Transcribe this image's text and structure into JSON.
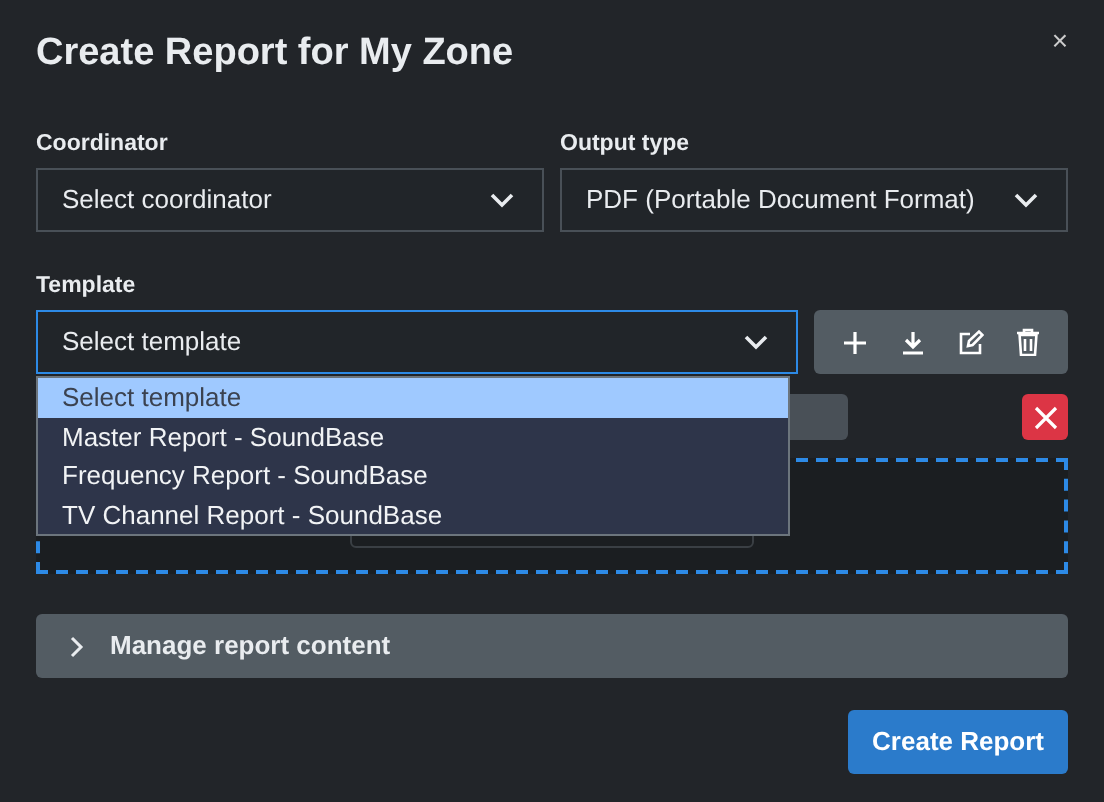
{
  "dialog": {
    "title": "Create Report for My Zone",
    "close": "×"
  },
  "coordinator": {
    "label": "Coordinator",
    "value": "Select coordinator"
  },
  "output_type": {
    "label": "Output type",
    "value": "PDF (Portable Document Format)"
  },
  "template": {
    "label": "Template",
    "value": "Select template",
    "focused": true,
    "expanded": true,
    "options": [
      {
        "label": "Select template",
        "selected": true
      },
      {
        "label": "Master Report - SoundBase",
        "selected": false
      },
      {
        "label": "Frequency Report - SoundBase",
        "selected": false
      },
      {
        "label": "TV Channel Report - SoundBase",
        "selected": false
      }
    ]
  },
  "accordion": {
    "label": "Manage report content",
    "expanded": false
  },
  "submit": "Create Report"
}
